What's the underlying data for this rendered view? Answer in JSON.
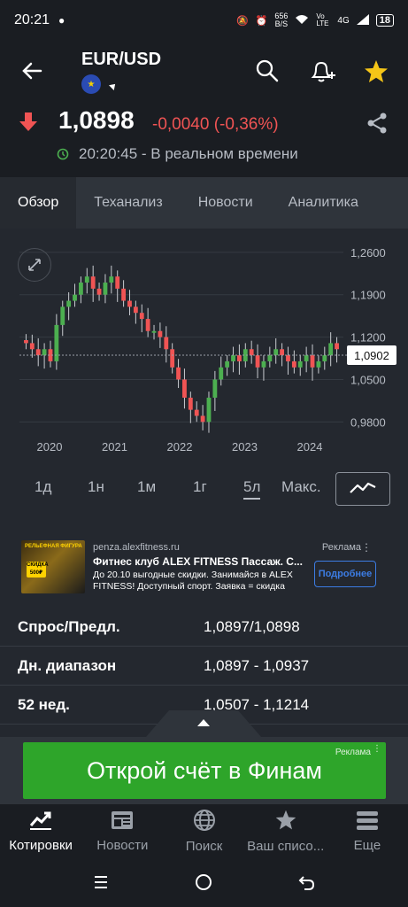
{
  "status_bar": {
    "time": "20:21",
    "net_speed_top": "656",
    "net_speed_unit": "B/S",
    "network": "4G",
    "volte": "Vo LTE",
    "battery": "18"
  },
  "header": {
    "title": "EUR/USD",
    "icons": [
      "back-arrow-icon",
      "search-icon",
      "add-alert-icon",
      "star-icon"
    ],
    "star_color": "#f5c518"
  },
  "quote": {
    "price": "1,0898",
    "change": "-0,0040 (-0,36%)",
    "timestamp": "20:20:45 - В реальном времени",
    "change_color": "#f05454"
  },
  "tabs": [
    {
      "label": "Обзор",
      "active": true
    },
    {
      "label": "Теханализ",
      "active": false
    },
    {
      "label": "Новости",
      "active": false
    },
    {
      "label": "Аналитика",
      "active": false
    }
  ],
  "chart_data": {
    "type": "candlestick",
    "x_ticks": [
      "2020",
      "2021",
      "2022",
      "2023",
      "2024"
    ],
    "y_ticks": [
      "1,2600",
      "1,1900",
      "1,1200",
      "1,0500",
      "0,9800"
    ],
    "ylim": [
      0.96,
      1.27
    ],
    "current_value_label": "1,0902",
    "up_color": "#4caf50",
    "down_color": "#f05454",
    "approx_close_series": [
      1.11,
      1.1,
      1.09,
      1.1,
      1.08,
      1.14,
      1.17,
      1.18,
      1.19,
      1.21,
      1.22,
      1.2,
      1.19,
      1.21,
      1.22,
      1.2,
      1.18,
      1.17,
      1.16,
      1.15,
      1.13,
      1.13,
      1.12,
      1.1,
      1.07,
      1.05,
      1.02,
      1.0,
      0.99,
      0.98,
      1.02,
      1.05,
      1.07,
      1.08,
      1.09,
      1.08,
      1.1,
      1.09,
      1.07,
      1.08,
      1.09,
      1.1,
      1.09,
      1.08,
      1.07,
      1.08,
      1.09,
      1.07,
      1.08,
      1.09,
      1.11,
      1.1
    ]
  },
  "periods": [
    {
      "label": "1д",
      "active": false
    },
    {
      "label": "1н",
      "active": false
    },
    {
      "label": "1м",
      "active": false
    },
    {
      "label": "1г",
      "active": false
    },
    {
      "label": "5л",
      "active": true
    },
    {
      "label": "Макс.",
      "active": false
    }
  ],
  "ad": {
    "domain": "penza.alexfitness.ru",
    "label": "Реклама",
    "title": "Фитнес клуб ALEX FITNESS Пассаж. С...",
    "description": "До 20.10 выгодные скидки. Занимайся в ALEX FITNESS! Доступный спорт. Заявка = скидка",
    "button": "Подробнее",
    "image_text_top": "РЕЛЬЕФНАЯ ФИГУРА",
    "image_badge": "СКИДКА 500₽"
  },
  "stats": [
    {
      "label": "Спрос/Предл.",
      "value": "1,0897/1,0898"
    },
    {
      "label": "Дн. диапазон",
      "value": "1,0897 - 1,0937"
    },
    {
      "label": "52 нед.",
      "value": "1,0507 - 1,1214"
    }
  ],
  "banner": {
    "text": "Открой счёт в Финам",
    "ad_label": "Реклама"
  },
  "bottom_nav": [
    {
      "label": "Котировки",
      "icon": "quotes-chart-icon",
      "active": true
    },
    {
      "label": "Новости",
      "icon": "news-icon",
      "active": false
    },
    {
      "label": "Поиск",
      "icon": "globe-icon",
      "active": false
    },
    {
      "label": "Ваш списо...",
      "icon": "star-icon",
      "active": false
    },
    {
      "label": "Еще",
      "icon": "menu-icon",
      "active": false
    }
  ]
}
